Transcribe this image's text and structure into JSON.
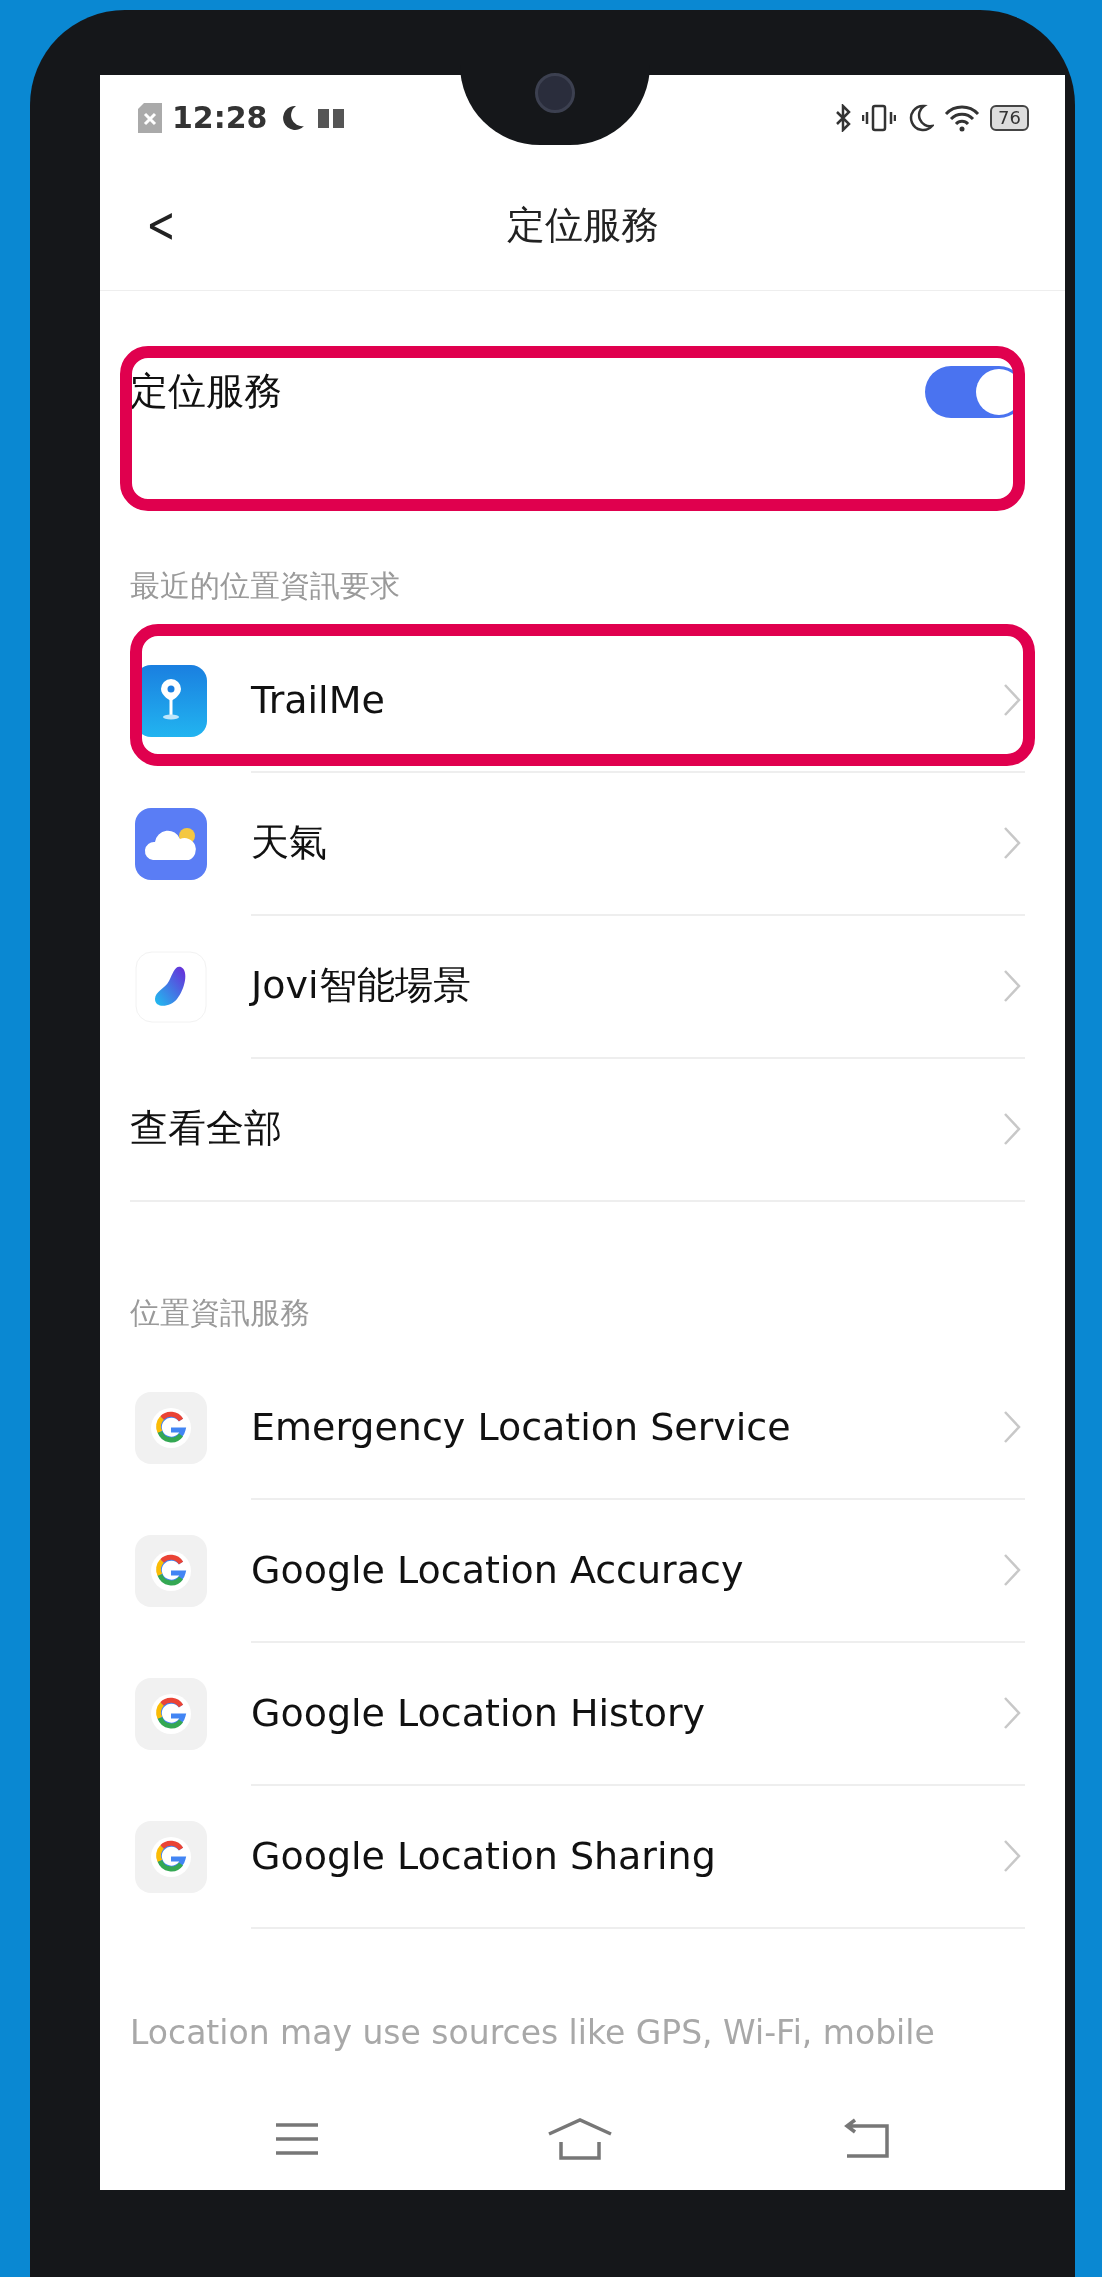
{
  "status_bar": {
    "time": "12:28",
    "battery": "76"
  },
  "header": {
    "back": "<",
    "title": "定位服務"
  },
  "master_toggle": {
    "label": "定位服務",
    "on": true,
    "highlighted": true
  },
  "recent_section": {
    "label": "最近的位置資訊要求",
    "items": [
      {
        "kind": "app",
        "label": "TrailMe",
        "highlighted": true
      },
      {
        "kind": "app",
        "label": "天氣",
        "highlighted": false
      },
      {
        "kind": "app",
        "label": "Jovi智能場景",
        "highlighted": false
      },
      {
        "kind": "link",
        "label": "查看全部",
        "highlighted": false
      }
    ]
  },
  "services_section": {
    "label": "位置資訊服務",
    "items": [
      {
        "kind": "app",
        "label": "Emergency Location Service",
        "highlighted": false
      },
      {
        "kind": "app",
        "label": "Google Location Accuracy",
        "highlighted": false
      },
      {
        "kind": "app",
        "label": "Google Location History",
        "highlighted": false
      },
      {
        "kind": "app",
        "label": "Google Location Sharing",
        "highlighted": false
      }
    ]
  },
  "footer": [
    "Location may use sources like GPS, Wi-Fi, mobile"
  ]
}
